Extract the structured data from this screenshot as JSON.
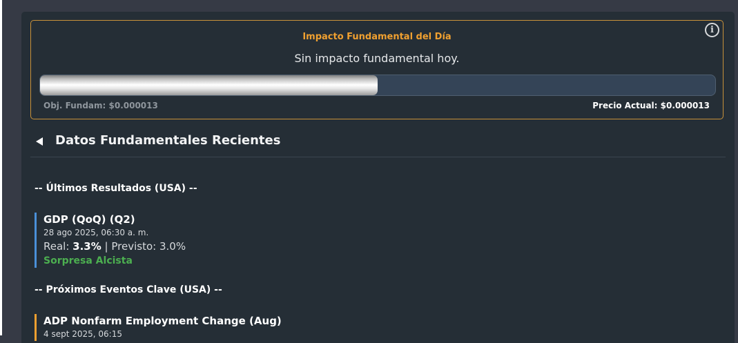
{
  "impact": {
    "title": "Impacto Fundamental del Día",
    "message": "Sin impacto fundamental hoy.",
    "info_icon": "info-icon",
    "progress_fraction": 0.5,
    "objective_label": "Obj. Fundam: $0.000013",
    "current_price_label": "Precio Actual: $0.000013"
  },
  "section": {
    "title": "Datos Fundamentales Recientes",
    "toggle_icon": "collapse-triangle-icon"
  },
  "results": {
    "heading": "-- Últimos Resultados (USA) --",
    "items": [
      {
        "title": "GDP (QoQ) (Q2)",
        "date": "28 ago 2025, 06:30 a. m.",
        "real_label": "Real: ",
        "real_value": "3.3%",
        "separator": " | ",
        "forecast_label": "Previsto: 3.0%",
        "surprise": "Sorpresa Alcista"
      }
    ]
  },
  "upcoming": {
    "heading": "-- Próximos Eventos Clave (USA) --",
    "items": [
      {
        "title": "ADP Nonfarm Employment Change (Aug)",
        "date_partial": "4 sept 2025, 06:15"
      }
    ]
  },
  "colors": {
    "accent_orange": "#f0a030",
    "past_event_bar": "#4a90d9",
    "surprise_green": "#4caf50",
    "panel_bg": "#252e36"
  }
}
